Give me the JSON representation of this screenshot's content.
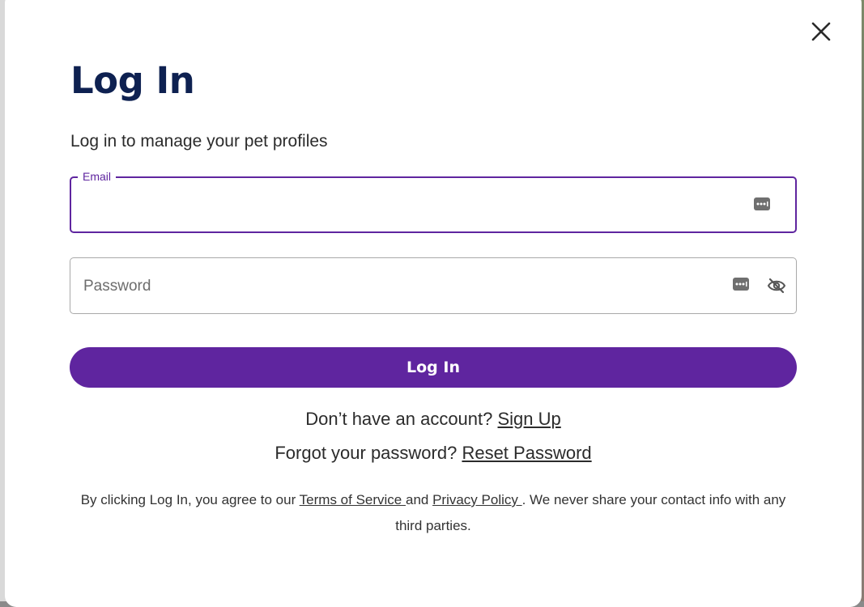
{
  "modal": {
    "title": "Log In",
    "subtitle": "Log in to manage your pet profiles",
    "close_icon": "close-icon"
  },
  "email": {
    "label": "Email",
    "value": "",
    "placeholder": "",
    "icon": "password-manager-key-icon"
  },
  "password": {
    "value": "",
    "placeholder": "Password",
    "icons": [
      "password-manager-key-icon",
      "eye-slash-icon"
    ]
  },
  "login_button": {
    "label": "Log In"
  },
  "signup": {
    "prompt": "Don’t have an account? ",
    "link": "Sign Up"
  },
  "reset": {
    "prompt": "Forgot your password? ",
    "link": "Reset Password"
  },
  "legal": {
    "prefix": "By clicking Log In, you agree to our ",
    "terms": "Terms of Service ",
    "and": "and ",
    "privacy": "Privacy Policy ",
    "suffix": ". We never share your contact info with any third parties."
  },
  "colors": {
    "accent": "#5f259f",
    "title": "#0e2151",
    "text": "#2b2b2b",
    "border": "#a9a9a9"
  }
}
